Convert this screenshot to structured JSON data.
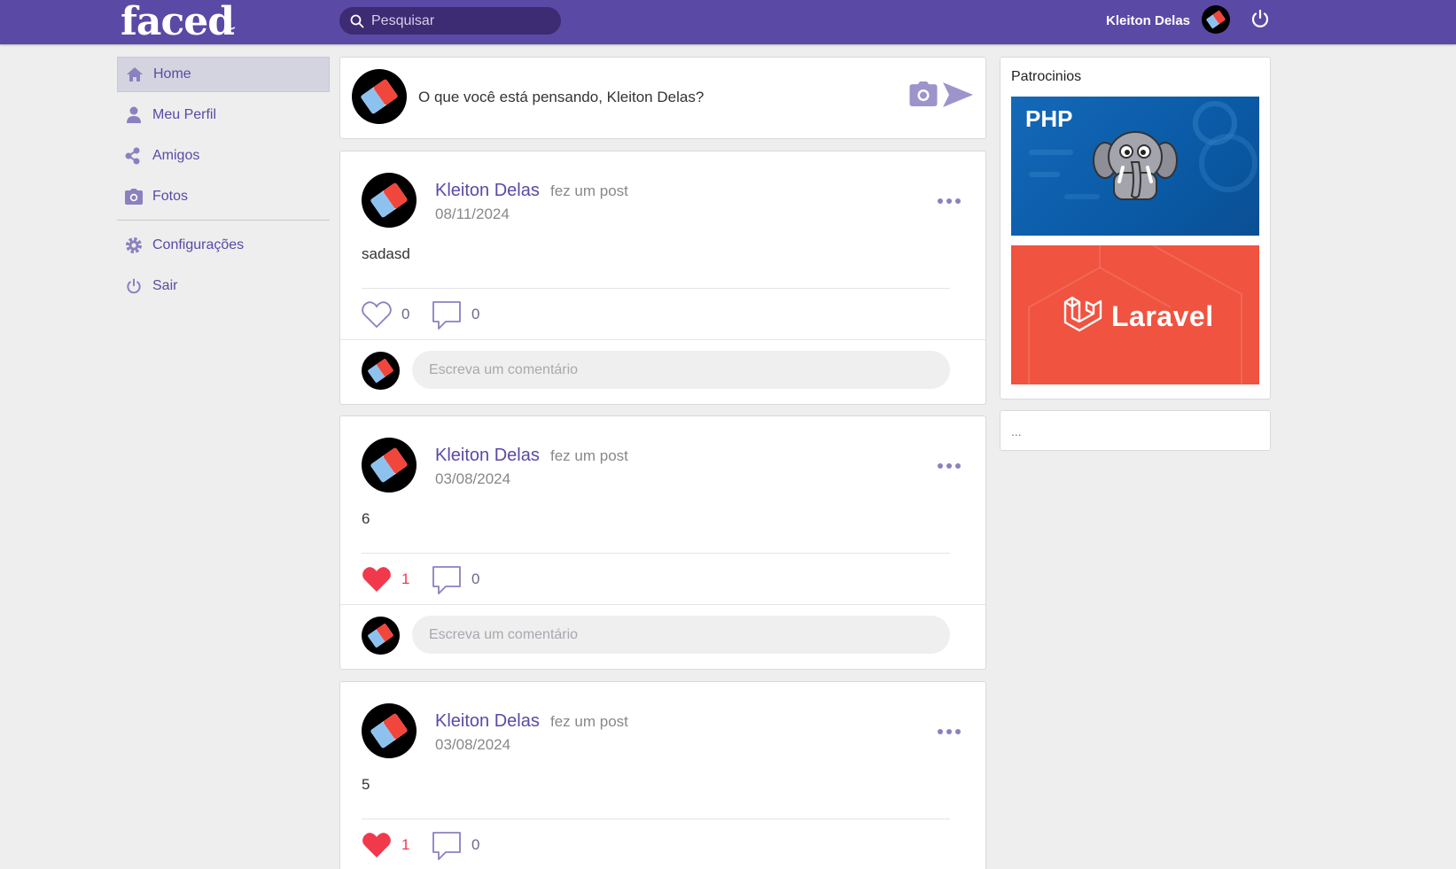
{
  "header": {
    "logo": "faced",
    "search_placeholder": "Pesquisar",
    "user_name": "Kleiton Delas"
  },
  "menu": {
    "items": [
      {
        "label": "Home",
        "icon": "home-icon"
      },
      {
        "label": "Meu Perfil",
        "icon": "user-icon"
      },
      {
        "label": "Amigos",
        "icon": "friends-icon"
      },
      {
        "label": "Fotos",
        "icon": "camera-icon"
      },
      {
        "label": "Configurações",
        "icon": "gear-icon"
      },
      {
        "label": "Sair",
        "icon": "power-icon"
      }
    ]
  },
  "composer": {
    "prompt": "O que você está pensando, Kleiton Delas?"
  },
  "posts": [
    {
      "author": "Kleiton Delas",
      "action": "fez um post",
      "date": "08/11/2024",
      "body": "sadasd",
      "likes": "0",
      "liked": false,
      "comments": "0",
      "comment_placeholder": "Escreva um comentário"
    },
    {
      "author": "Kleiton Delas",
      "action": "fez um post",
      "date": "03/08/2024",
      "body": "6",
      "likes": "1",
      "liked": true,
      "comments": "0",
      "comment_placeholder": "Escreva um comentário"
    },
    {
      "author": "Kleiton Delas",
      "action": "fez um post",
      "date": "03/08/2024",
      "body": "5",
      "likes": "1",
      "liked": true,
      "comments": "0",
      "comment_placeholder": "Escreva um comentário"
    }
  ],
  "sidebar": {
    "sponsors_title": "Patrocinios",
    "ads": [
      {
        "label": "PHP"
      },
      {
        "label": "Laravel"
      }
    ],
    "extra": "..."
  },
  "colors": {
    "brand": "#5b49a6",
    "like": "#f2384b",
    "background": "#eeeeee"
  }
}
